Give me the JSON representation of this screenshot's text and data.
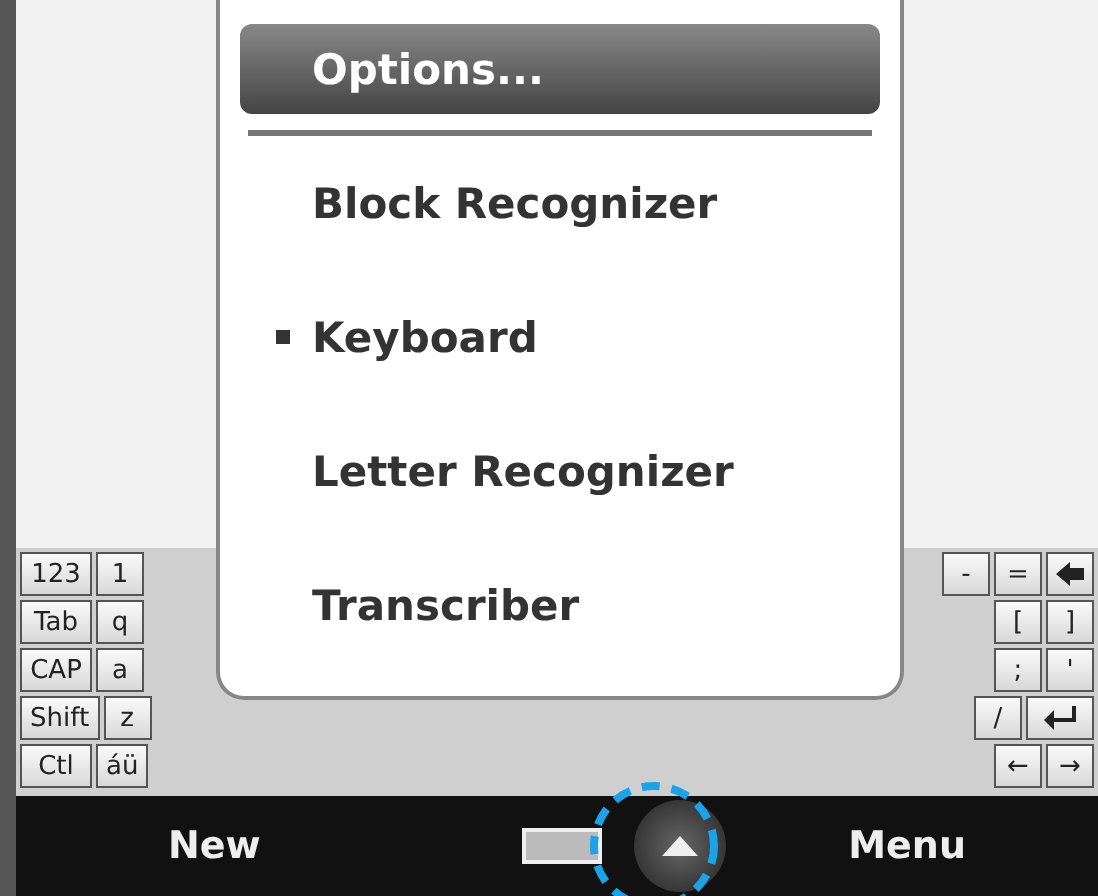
{
  "keyboard": {
    "rows": [
      {
        "left": [
          {
            "kind": "text",
            "label": "123"
          },
          {
            "kind": "text",
            "label": "1"
          }
        ],
        "right": [
          {
            "kind": "text",
            "label": "-"
          },
          {
            "kind": "text",
            "label": "="
          },
          {
            "kind": "backspace"
          }
        ]
      },
      {
        "left": [
          {
            "kind": "text",
            "label": "Tab"
          },
          {
            "kind": "text",
            "label": "q"
          }
        ],
        "right": [
          {
            "kind": "text",
            "label": "["
          },
          {
            "kind": "text",
            "label": "]"
          }
        ]
      },
      {
        "left": [
          {
            "kind": "text",
            "label": "CAP"
          },
          {
            "kind": "text",
            "label": "a"
          }
        ],
        "right": [
          {
            "kind": "text",
            "label": ";"
          },
          {
            "kind": "text",
            "label": "'"
          }
        ]
      },
      {
        "left": [
          {
            "kind": "text",
            "label": "Shift"
          },
          {
            "kind": "text",
            "label": "z"
          }
        ],
        "right": [
          {
            "kind": "text",
            "label": "/"
          },
          {
            "kind": "enter"
          }
        ]
      },
      {
        "left": [
          {
            "kind": "text",
            "label": "Ctl"
          },
          {
            "kind": "text",
            "label": "áü"
          }
        ],
        "right": [
          {
            "kind": "text",
            "label": "←"
          },
          {
            "kind": "text",
            "label": "→"
          }
        ]
      }
    ]
  },
  "menu": {
    "items": [
      {
        "kind": "header",
        "label": "Options...",
        "selected": true
      },
      {
        "kind": "item",
        "label": "Block Recognizer",
        "selected": false,
        "checked": false
      },
      {
        "kind": "item",
        "label": "Keyboard",
        "selected": false,
        "checked": true
      },
      {
        "kind": "item",
        "label": "Letter Recognizer",
        "selected": false,
        "checked": false
      },
      {
        "kind": "item",
        "label": "Transcriber",
        "selected": false,
        "checked": false
      }
    ]
  },
  "softkeys": {
    "left": "New",
    "right": "Menu"
  }
}
